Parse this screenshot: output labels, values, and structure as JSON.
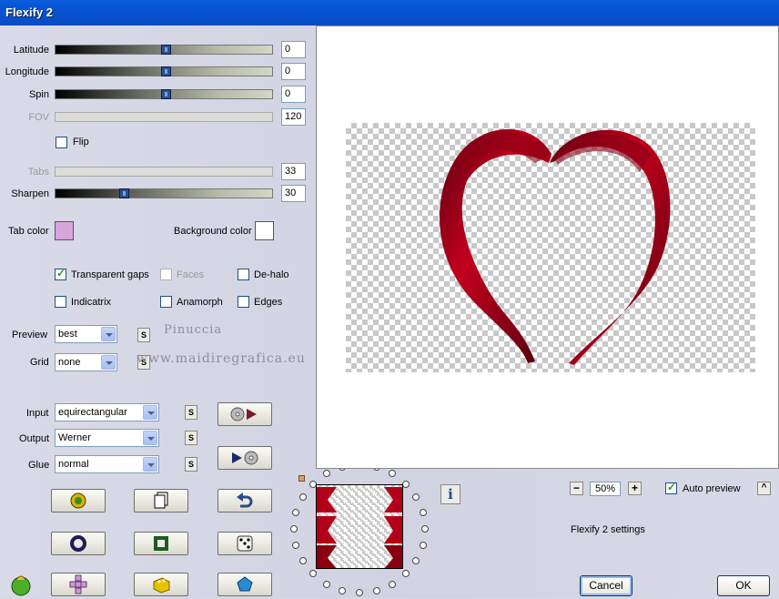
{
  "window": {
    "title": "Flexify 2"
  },
  "sliders": [
    {
      "label": "Latitude",
      "value": "0",
      "level": 0.5,
      "enabled": true
    },
    {
      "label": "Longitude",
      "value": "0",
      "level": 0.5,
      "enabled": true
    },
    {
      "label": "Spin",
      "value": "0",
      "level": 0.5,
      "enabled": true
    },
    {
      "label": "FOV",
      "value": "120",
      "enabled": false
    },
    {
      "label": "Tabs",
      "value": "33",
      "enabled": false
    },
    {
      "label": "Sharpen",
      "value": "30",
      "level": 0.3,
      "enabled": true
    }
  ],
  "flip": {
    "label": "Flip",
    "checked": false
  },
  "colors": {
    "tab_label": "Tab color",
    "tab_color": "#d8a6dc",
    "background_label": "Background color",
    "background_color": "#ffffff"
  },
  "options": {
    "transparent_gaps": {
      "label": "Transparent gaps",
      "checked": true
    },
    "faces": {
      "label": "Faces",
      "checked": false,
      "enabled": false
    },
    "de_halo": {
      "label": "De-halo",
      "checked": false
    },
    "indicatrix": {
      "label": "Indicatrix",
      "checked": false
    },
    "anamorph": {
      "label": "Anamorph",
      "checked": false
    },
    "edges": {
      "label": "Edges",
      "checked": false
    }
  },
  "preview_quality": {
    "label": "Preview",
    "value": "best"
  },
  "grid": {
    "label": "Grid",
    "value": "none"
  },
  "input": {
    "label": "Input",
    "value": "equirectangular"
  },
  "output": {
    "label": "Output",
    "value": "Werner"
  },
  "glue": {
    "label": "Glue",
    "value": "normal"
  },
  "s_button": "S",
  "watermark": {
    "line1": "Pinuccia",
    "line2": "www.maidiregrafica.eu"
  },
  "zoom": {
    "minus": "−",
    "value": "50%",
    "plus": "+"
  },
  "auto_preview": {
    "label": "Auto preview",
    "checked": true
  },
  "collapse_button": "^",
  "info_button": "i",
  "settings_label": "Flexify 2 settings",
  "buttons": {
    "cancel": "Cancel",
    "ok": "OK"
  },
  "accent": {
    "heart_red": "#b3001a",
    "heart_dark": "#5a0010"
  }
}
